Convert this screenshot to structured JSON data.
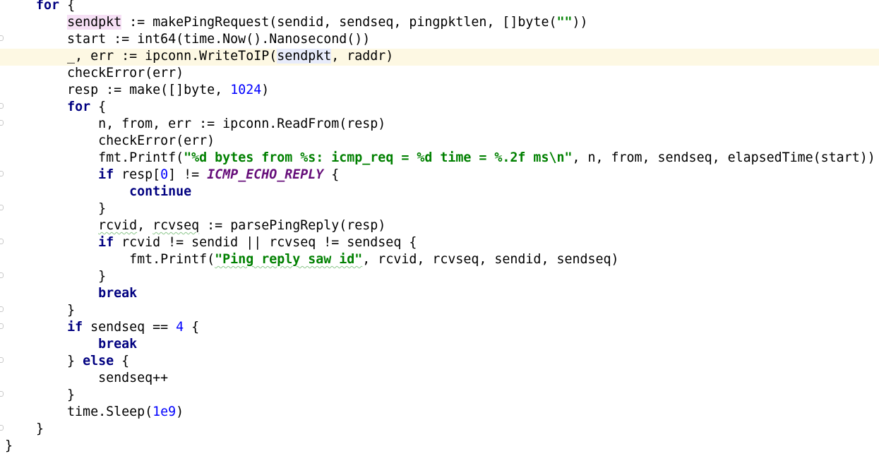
{
  "editor": {
    "lines": [
      [
        "    ",
        {
          "kw": "for"
        },
        " {"
      ],
      [
        "        ",
        {
          "hl": "sendpkt"
        },
        " := makePingRequest(sendid, sendseq, pingpktlen, []byte(",
        {
          "str": "\"\""
        },
        "))"
      ],
      [
        "        start := int64(time.Now().Nanosecond())"
      ],
      [
        "        _, err := ipconn.WriteToIP(",
        {
          "hl2": "sendpkt"
        },
        ", raddr)"
      ],
      [
        "        checkError(err)"
      ],
      [
        "        resp := make([]byte, ",
        {
          "num": "1024"
        },
        ")"
      ],
      [
        "        ",
        {
          "kw": "for"
        },
        " {"
      ],
      [
        "            n, from, err := ipconn.ReadFrom(resp)"
      ],
      [
        "            checkError(err)"
      ],
      [
        "            fmt.Printf(",
        {
          "str": "\"%d bytes from %s: icmp_req = %d time = %.2f ms\\n\""
        },
        ", n, from, sendseq, elapsedTime(start))"
      ],
      [
        "            ",
        {
          "kw": "if"
        },
        " resp[",
        {
          "num": "0"
        },
        "] != ",
        {
          "const": "ICMP_ECHO_REPLY"
        },
        " {"
      ],
      [
        "                ",
        {
          "kw": "continue"
        }
      ],
      [
        "            }"
      ],
      [
        "            ",
        {
          "sq": "rcvid"
        },
        ", ",
        {
          "sq": "rcvseq"
        },
        " := parsePingReply(resp)"
      ],
      [
        "            ",
        {
          "kw": "if"
        },
        " rcvid != sendid || rcvseq != sendseq {"
      ],
      [
        "                fmt.Printf(",
        {
          "strsq": "\"Ping reply saw id\""
        },
        ", rcvid, rcvseq, sendid, sendseq)"
      ],
      [
        "            }"
      ],
      [
        "            ",
        {
          "kw": "break"
        }
      ],
      [
        "        }"
      ],
      [
        "        ",
        {
          "kw": "if"
        },
        " sendseq == ",
        {
          "num": "4"
        },
        " {"
      ],
      [
        "            ",
        {
          "kw": "break"
        }
      ],
      [
        "        } ",
        {
          "kw": "else"
        },
        " {"
      ],
      [
        "            sendseq++"
      ],
      [
        "        }"
      ],
      [
        "        time.Sleep(",
        {
          "num": "1e9"
        },
        ")"
      ],
      [
        "    }"
      ],
      [
        "}"
      ]
    ]
  }
}
